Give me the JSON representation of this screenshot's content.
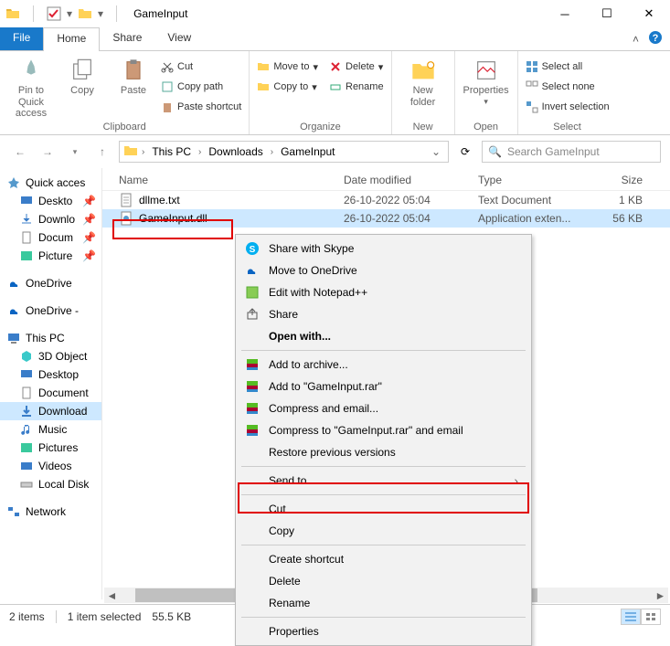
{
  "titlebar": {
    "title": "GameInput"
  },
  "tabs": {
    "file": "File",
    "home": "Home",
    "share": "Share",
    "view": "View"
  },
  "ribbon": {
    "pin": "Pin to Quick\naccess",
    "copy": "Copy",
    "paste": "Paste",
    "cut": "Cut",
    "copypath": "Copy path",
    "pasteshortcut": "Paste shortcut",
    "clipboard_label": "Clipboard",
    "moveto": "Move to",
    "copyto": "Copy to",
    "delete": "Delete",
    "rename": "Rename",
    "organize_label": "Organize",
    "newfolder": "New\nfolder",
    "new_label": "New",
    "properties": "Properties",
    "open_label": "Open",
    "selectall": "Select all",
    "selectnone": "Select none",
    "invertsel": "Invert selection",
    "select_label": "Select"
  },
  "breadcrumb": {
    "a": "This PC",
    "b": "Downloads",
    "c": "GameInput"
  },
  "search": {
    "placeholder": "Search GameInput"
  },
  "columns": {
    "name": "Name",
    "date": "Date modified",
    "type": "Type",
    "size": "Size"
  },
  "files": [
    {
      "name": "dllme.txt",
      "date": "26-10-2022 05:04",
      "type": "Text Document",
      "size": "1 KB",
      "icon": "txt"
    },
    {
      "name": "GameInput.dll",
      "date": "26-10-2022 05:04",
      "type": "Application exten...",
      "size": "56 KB",
      "icon": "dll"
    }
  ],
  "nav": {
    "quick": "Quick acces",
    "deskto": "Deskto",
    "downlo": "Downlo",
    "docum": "Docum",
    "picture": "Picture",
    "onedrive": "OneDrive",
    "onedrive2": "OneDrive -",
    "thispc": "This PC",
    "obj3d": "3D Object",
    "desktop": "Desktop",
    "documents": "Document",
    "downloads": "Download",
    "music": "Music",
    "pictures": "Pictures",
    "videos": "Videos",
    "localdisk": "Local Disk",
    "network": "Network"
  },
  "ctx": {
    "skype": "Share with Skype",
    "onedrive": "Move to OneDrive",
    "notepad": "Edit with Notepad++",
    "share": "Share",
    "openwith": "Open with...",
    "addarchive": "Add to archive...",
    "addrar": "Add to \"GameInput.rar\"",
    "compressemail": "Compress and email...",
    "compressraremail": "Compress to \"GameInput.rar\" and email",
    "restore": "Restore previous versions",
    "sendto": "Send to",
    "cut": "Cut",
    "copy": "Copy",
    "createshortcut": "Create shortcut",
    "delete": "Delete",
    "rename": "Rename",
    "properties": "Properties"
  },
  "status": {
    "items": "2 items",
    "selected": "1 item selected",
    "size": "55.5 KB"
  }
}
